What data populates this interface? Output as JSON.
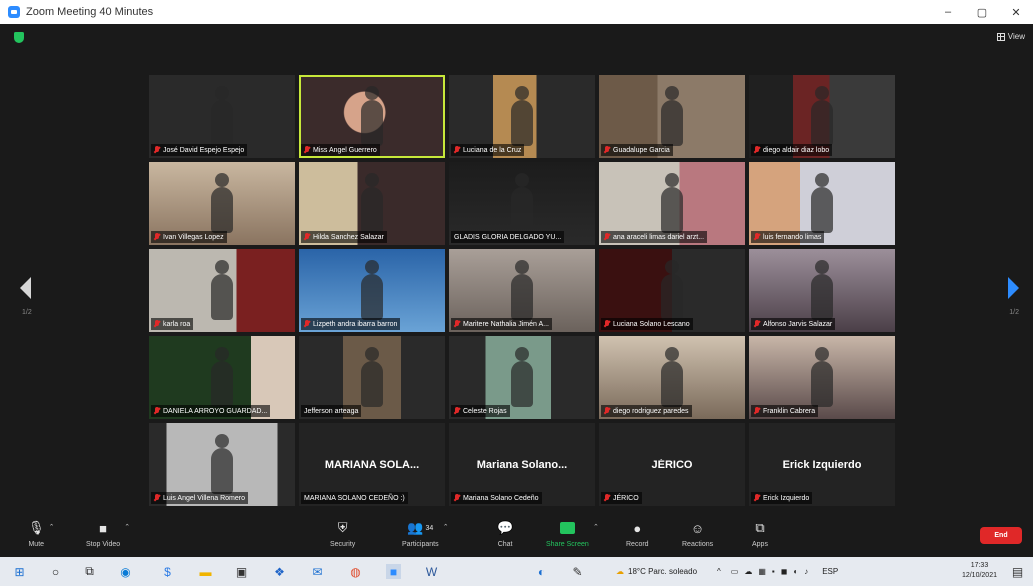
{
  "window": {
    "title": "Zoom Meeting 40 Minutes",
    "minimize": "–",
    "maximize": "▢",
    "close": "✕"
  },
  "view_label": "View",
  "pages": {
    "left": "1/2",
    "right": "1/2"
  },
  "participants": [
    {
      "name": "José David Espejo Espejo",
      "big": ""
    },
    {
      "name": "Miss Angel Guerrero",
      "big": "",
      "active": true
    },
    {
      "name": "Luciana de la Cruz",
      "big": ""
    },
    {
      "name": "Guadalupe Garcia",
      "big": ""
    },
    {
      "name": "diego aldair diaz lobo",
      "big": ""
    },
    {
      "name": "Ivan Villegas Lopez",
      "big": ""
    },
    {
      "name": "Hilda Sanchez Salazar",
      "big": ""
    },
    {
      "name": "GLADIS GLORIA DELGADO YU...",
      "big": ""
    },
    {
      "name": "ana araceli limas dariel arzt...",
      "big": ""
    },
    {
      "name": "luis fernando limas",
      "big": ""
    },
    {
      "name": "karla roa",
      "big": ""
    },
    {
      "name": "Lizpeth andra ibarra barron",
      "big": ""
    },
    {
      "name": "Maritere Nathalia Jimén A...",
      "big": ""
    },
    {
      "name": "Luciana Solano Lescano",
      "big": ""
    },
    {
      "name": "Alfonso Jarvis Salazar",
      "big": ""
    },
    {
      "name": "DANIELA ARROYO GUARDAD...",
      "big": ""
    },
    {
      "name": "Jefferson arteaga",
      "big": ""
    },
    {
      "name": "Celeste Rojas",
      "big": ""
    },
    {
      "name": "diego rodriguez paredes",
      "big": ""
    },
    {
      "name": "Franklin Cabrera",
      "big": ""
    },
    {
      "name": "Luis Angel Villena Romero",
      "big": ""
    },
    {
      "name": "MARIANA SOLANO CEDEÑO :)",
      "big": "MARIANA  SOLA..."
    },
    {
      "name": "Mariana Solano Cedeño",
      "big": "Mariana  Solano..."
    },
    {
      "name": "JÉRICO",
      "big": "JÉRICO"
    },
    {
      "name": "Erick Izquierdo",
      "big": "Erick Izquierdo"
    }
  ],
  "toolbar": {
    "mute": "Mute",
    "stop_video": "Stop Video",
    "security": "Security",
    "participants": "Participants",
    "participants_count": "34",
    "chat": "Chat",
    "share_screen": "Share Screen",
    "record": "Record",
    "reactions": "Reactions",
    "apps": "Apps",
    "end": "End"
  },
  "taskbar": {
    "weather": "18°C  Parc. soleado",
    "lang": "ESP",
    "time": "17:33",
    "date": "12/10/2021"
  },
  "colors": {
    "zoom_blue": "#2d8cff",
    "end_red": "#e02828",
    "active_border": "#c7e83a",
    "share_green": "#23c45e"
  }
}
